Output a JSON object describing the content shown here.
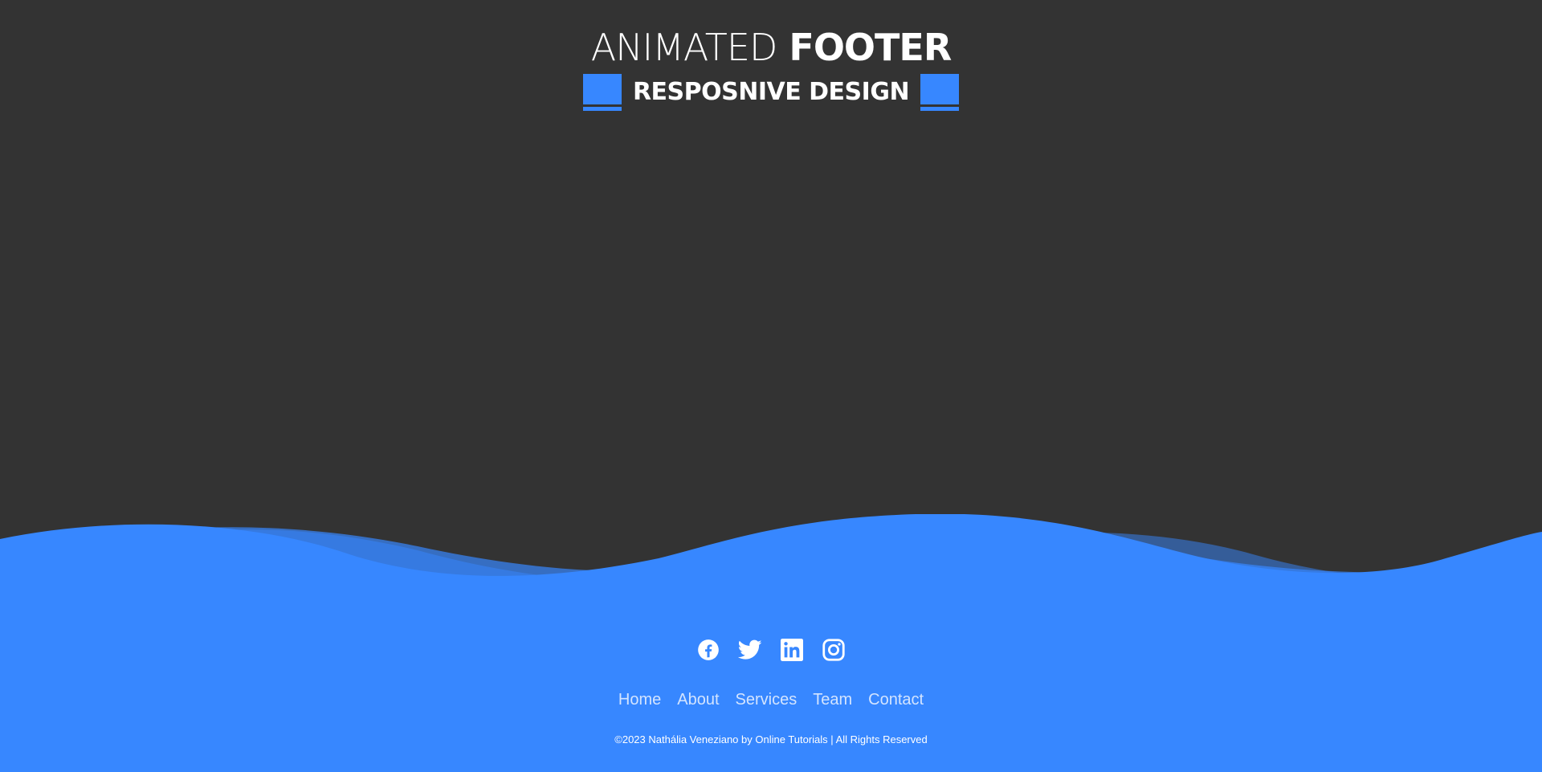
{
  "header": {
    "title_light": "ANIMATED",
    "title_bold": "FOOTER",
    "subtitle": "RESPOSNIVE DESIGN"
  },
  "footer": {
    "social": [
      {
        "icon": "facebook-icon"
      },
      {
        "icon": "twitter-icon"
      },
      {
        "icon": "linkedin-icon"
      },
      {
        "icon": "instagram-icon"
      }
    ],
    "nav": [
      "Home",
      "About",
      "Services",
      "Team",
      "Contact"
    ],
    "copyright": "©2023 Nathália Veneziano by Online Tutorials | All Rights Reserved"
  },
  "colors": {
    "background": "#333333",
    "accent": "#3787ff",
    "text": "#ffffff"
  }
}
